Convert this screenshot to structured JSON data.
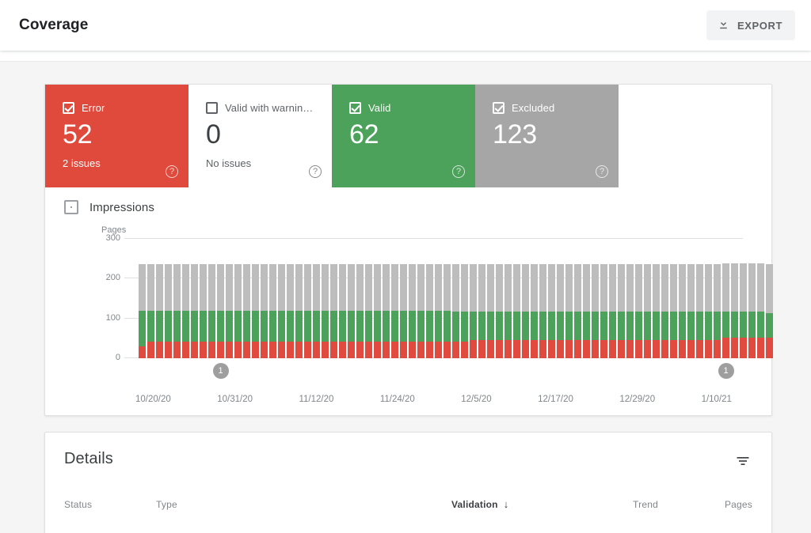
{
  "header": {
    "title": "Coverage",
    "export_label": "EXPORT",
    "export_icon": "download-icon"
  },
  "status_tiles": [
    {
      "label": "Error",
      "value": "52",
      "sub": "2 issues",
      "checked": true,
      "tone": "error",
      "help_icon": "help-icon",
      "color": "#df4a3c"
    },
    {
      "label": "Valid with warnin…",
      "value": "0",
      "sub": "No issues",
      "checked": false,
      "tone": "warning",
      "help_icon": "help-icon",
      "color": "#ffffff"
    },
    {
      "label": "Valid",
      "value": "62",
      "sub": "",
      "checked": true,
      "tone": "valid",
      "help_icon": "help-icon",
      "color": "#4ca25b"
    },
    {
      "label": "Excluded",
      "value": "123",
      "sub": "",
      "checked": true,
      "tone": "excluded",
      "help_icon": "help-icon",
      "color": "#a6a6a6"
    }
  ],
  "chart_toggle": {
    "label": "Impressions",
    "state": "indeterminate"
  },
  "details": {
    "title": "Details",
    "filter_icon": "filter-icon",
    "columns": {
      "status": "Status",
      "type": "Type",
      "validation": "Validation",
      "sort_arrow": "↓",
      "trend": "Trend",
      "pages": "Pages"
    }
  },
  "chart_data": {
    "type": "bar",
    "stacked": true,
    "title": "",
    "xlabel": "",
    "ylabel": "Pages",
    "ylim": [
      0,
      300
    ],
    "yticks": [
      0,
      100,
      200,
      300
    ],
    "grid": true,
    "legend_position": "none",
    "x_tick_labels": [
      "10/20/20",
      "10/31/20",
      "11/12/20",
      "11/24/20",
      "12/5/20",
      "12/17/20",
      "12/29/20",
      "1/10/21"
    ],
    "annotations": [
      {
        "label": "1",
        "index": 9
      },
      {
        "label": "1",
        "index": 67
      }
    ],
    "series": [
      {
        "name": "Error",
        "color": "#e04a3f",
        "values": [
          29,
          41,
          41,
          41,
          41,
          41,
          41,
          41,
          41,
          41,
          41,
          41,
          41,
          41,
          41,
          41,
          41,
          41,
          41,
          41,
          41,
          41,
          41,
          41,
          41,
          41,
          41,
          41,
          41,
          41,
          41,
          41,
          41,
          41,
          41,
          41,
          42,
          42,
          46,
          46,
          46,
          46,
          46,
          46,
          46,
          46,
          46,
          46,
          46,
          46,
          46,
          46,
          46,
          46,
          46,
          46,
          46,
          46,
          46,
          46,
          46,
          46,
          46,
          46,
          46,
          46,
          46,
          52,
          52,
          52,
          52,
          52,
          52
        ]
      },
      {
        "name": "Valid",
        "color": "#4ca25b",
        "values": [
          90,
          78,
          78,
          78,
          78,
          78,
          78,
          78,
          78,
          78,
          78,
          78,
          78,
          78,
          78,
          78,
          78,
          78,
          78,
          78,
          78,
          78,
          78,
          78,
          78,
          78,
          78,
          78,
          78,
          78,
          78,
          78,
          78,
          78,
          78,
          78,
          76,
          76,
          72,
          72,
          72,
          72,
          72,
          72,
          72,
          72,
          72,
          72,
          72,
          72,
          72,
          72,
          72,
          72,
          72,
          72,
          72,
          72,
          72,
          72,
          72,
          72,
          72,
          72,
          72,
          72,
          72,
          66,
          66,
          66,
          66,
          66,
          62
        ]
      },
      {
        "name": "Excluded",
        "color": "#bdbdbd",
        "values": [
          118,
          118,
          118,
          118,
          118,
          118,
          118,
          118,
          118,
          118,
          118,
          118,
          118,
          118,
          118,
          118,
          118,
          118,
          118,
          118,
          118,
          118,
          118,
          118,
          118,
          118,
          118,
          118,
          118,
          118,
          118,
          118,
          118,
          118,
          118,
          118,
          119,
          119,
          119,
          119,
          119,
          119,
          119,
          119,
          119,
          119,
          119,
          119,
          119,
          119,
          119,
          119,
          119,
          119,
          119,
          119,
          119,
          119,
          119,
          119,
          119,
          119,
          119,
          119,
          119,
          119,
          119,
          121,
          121,
          121,
          121,
          121,
          123
        ]
      }
    ]
  }
}
